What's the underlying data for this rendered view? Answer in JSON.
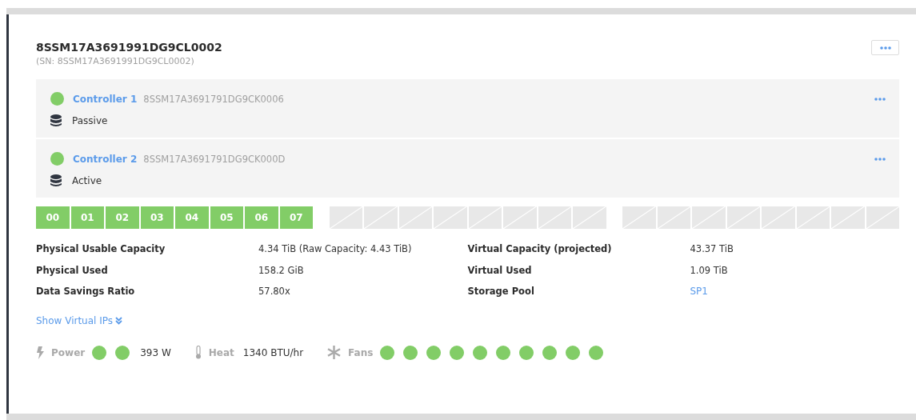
{
  "system": {
    "name": "8SSM17A3691991DG9CL0002",
    "serial": "(SN: 8SSM17A3691991DG9CL0002)"
  },
  "controllers": [
    {
      "name": "Controller 1",
      "serial": "8SSM17A3691791DG9CK0006",
      "role": "Passive",
      "healthy": true
    },
    {
      "name": "Controller 2",
      "serial": "8SSM17A3691791DG9CK000D",
      "role": "Active",
      "healthy": true
    }
  ],
  "slot_groups": [
    [
      {
        "label": "00",
        "filled": true
      },
      {
        "label": "01",
        "filled": true
      },
      {
        "label": "02",
        "filled": true
      },
      {
        "label": "03",
        "filled": true
      },
      {
        "label": "04",
        "filled": true
      },
      {
        "label": "05",
        "filled": true
      },
      {
        "label": "06",
        "filled": true
      },
      {
        "label": "07",
        "filled": true
      }
    ],
    [
      {
        "filled": false
      },
      {
        "filled": false
      },
      {
        "filled": false
      },
      {
        "filled": false
      },
      {
        "filled": false
      },
      {
        "filled": false
      },
      {
        "filled": false
      },
      {
        "filled": false
      }
    ],
    [
      {
        "filled": false
      },
      {
        "filled": false
      },
      {
        "filled": false
      },
      {
        "filled": false
      },
      {
        "filled": false
      },
      {
        "filled": false
      },
      {
        "filled": false
      },
      {
        "filled": false
      }
    ]
  ],
  "details_left": [
    {
      "label": "Physical Usable Capacity",
      "value": "4.34 TiB (Raw Capacity: 4.43 TiB)",
      "kind": "text"
    },
    {
      "label": "Physical Used",
      "value": "158.2 GiB",
      "kind": "text"
    },
    {
      "label": "Data Savings Ratio",
      "value": "57.80x",
      "kind": "text"
    }
  ],
  "details_right": [
    {
      "label": "Virtual Capacity (projected)",
      "value": "43.37 TiB",
      "kind": "text"
    },
    {
      "label": "Virtual Used",
      "value": "1.09 TiB",
      "kind": "text"
    },
    {
      "label": "Storage Pool",
      "value": "SP1",
      "kind": "link"
    }
  ],
  "show_virtual_ips": "Show Virtual IPs",
  "power": {
    "label": "Power",
    "supplies": [
      {
        "healthy": true
      },
      {
        "healthy": true
      }
    ],
    "reading": "393 W"
  },
  "heat": {
    "label": "Heat",
    "reading": "1340 BTU/hr"
  },
  "fans": {
    "label": "Fans",
    "units": [
      {
        "healthy": true
      },
      {
        "healthy": true
      },
      {
        "healthy": true
      },
      {
        "healthy": true
      },
      {
        "healthy": true
      },
      {
        "healthy": true
      },
      {
        "healthy": true
      },
      {
        "healthy": true
      },
      {
        "healthy": true
      },
      {
        "healthy": true
      }
    ]
  }
}
